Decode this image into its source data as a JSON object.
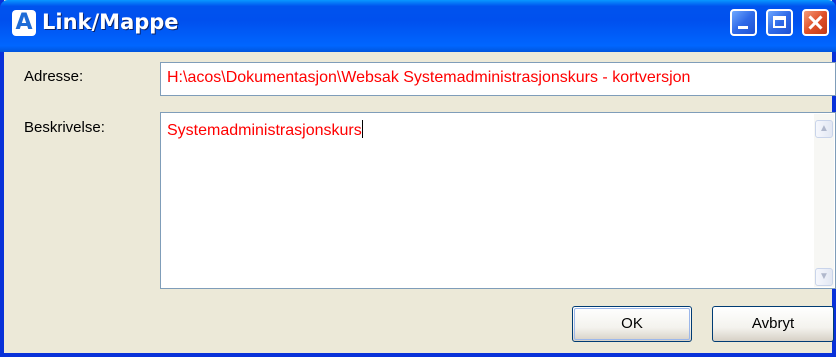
{
  "window": {
    "title": "Link/Mappe",
    "app_icon_glyph": "A",
    "controls": {
      "minimize": "minimize-icon",
      "maximize": "maximize-icon",
      "close": "close-icon"
    }
  },
  "form": {
    "adresse_label": "Adresse:",
    "adresse_value": "H:\\acos\\Dokumentasjon\\Websak Systemadministrasjonskurs - kortversjon",
    "beskrivelse_label": "Beskrivelse:",
    "beskrivelse_value": "Systemadministrasjonskurs"
  },
  "buttons": {
    "ok_label": "OK",
    "cancel_label": "Avbryt"
  },
  "colors": {
    "titlebar": "#0050ee",
    "field_text": "#ff0000",
    "window_bg": "#ece9d8"
  }
}
